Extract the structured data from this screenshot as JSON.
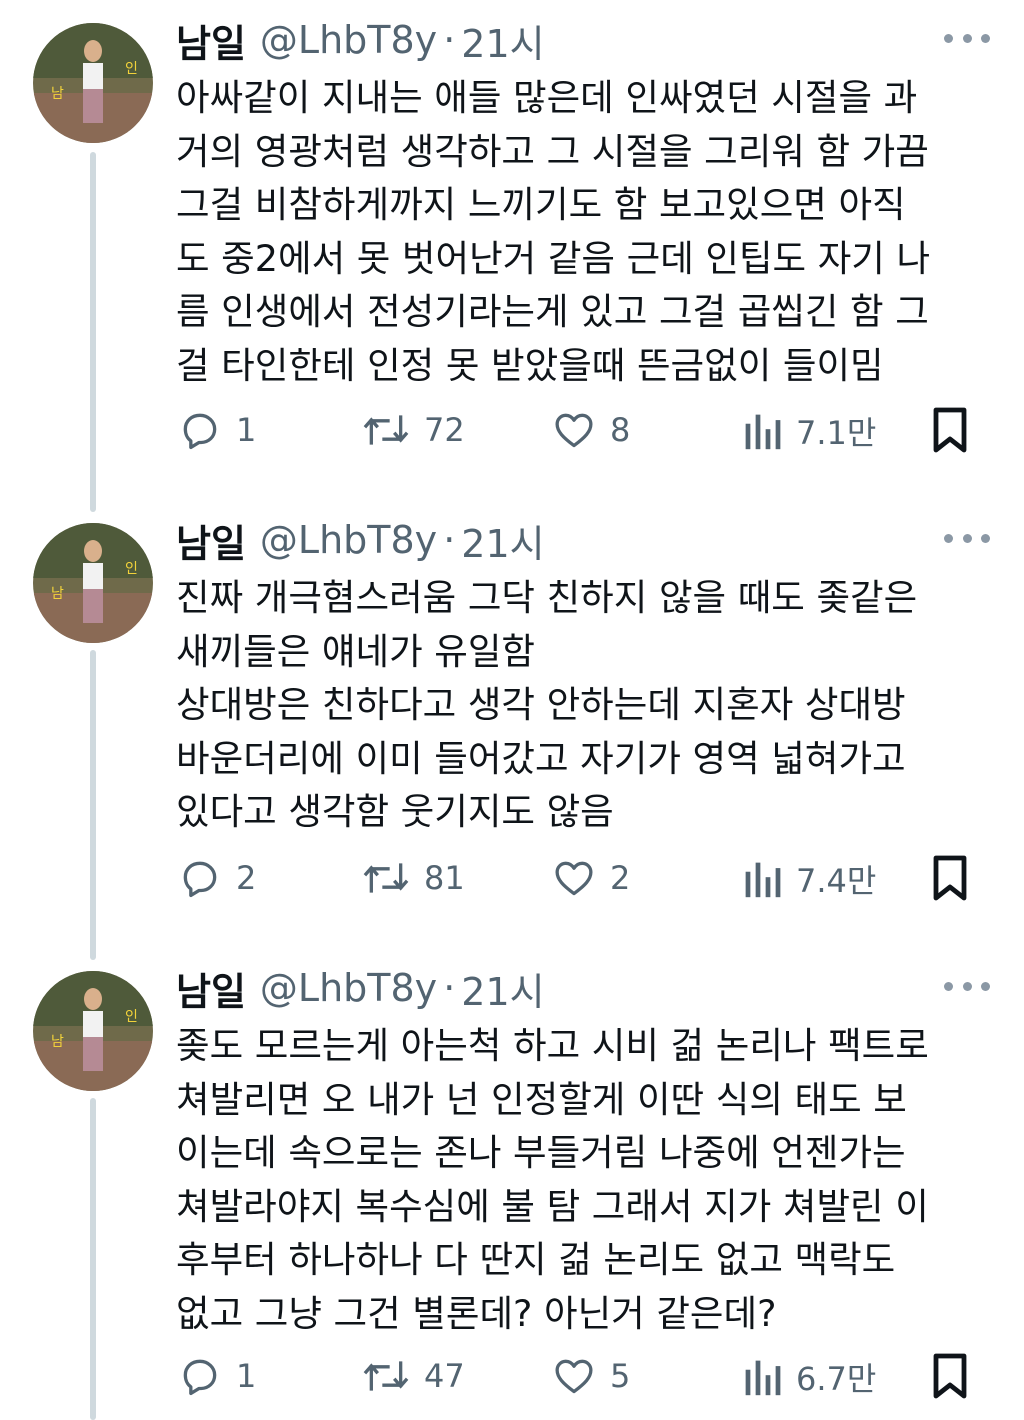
{
  "tweets": [
    {
      "name": "남일",
      "handle": "@LhbT8y",
      "dot": "·",
      "time": "21시",
      "lines": [
        "아싸같이 지내는 애들 많은데 인싸였던 시절을 과",
        "거의 영광처럼 생각하고 그 시절을 그리워 함 가끔",
        "그걸 비참하게까지 느끼기도 함 보고있으면 아직",
        "도 중2에서 못 벗어난거 같음 근데 인팁도 자기 나",
        "름 인생에서 전성기라는게 있고 그걸 곱씹긴 함 그",
        "걸 타인한테 인정 못 받았을때 뜬금없이 들이밈"
      ],
      "replies": "1",
      "retweets": "72",
      "likes": "8",
      "views": "7.1만"
    },
    {
      "name": "남일",
      "handle": "@LhbT8y",
      "dot": "·",
      "time": "21시",
      "lines": [
        "진짜 개극혐스러움 그닥 친하지 않을 때도 좆같은",
        "새끼들은 얘네가 유일함",
        "상대방은 친하다고 생각 안하는데 지혼자 상대방",
        "바운더리에 이미 들어갔고 자기가 영역 넓혀가고",
        "있다고 생각함 웃기지도 않음"
      ],
      "replies": "2",
      "retweets": "81",
      "likes": "2",
      "views": "7.4만"
    },
    {
      "name": "남일",
      "handle": "@LhbT8y",
      "dot": "·",
      "time": "21시",
      "lines": [
        "좆도 모르는게 아는척 하고 시비 걺 논리나 팩트로",
        "쳐발리면 오 내가 넌 인정할게 이딴 식의 태도 보",
        "이는데 속으로는 존나 부들거림 나중에 언젠가는",
        "쳐발라야지 복수심에 불 탐 그래서 지가 쳐발린 이",
        "후부터 하나하나 다 딴지 걺 논리도 없고 맥락도",
        "없고 그냥 그건 별론데? 아닌거 같은데?"
      ],
      "replies": "1",
      "retweets": "47",
      "likes": "5",
      "views": "6.7만"
    }
  ],
  "icons": {
    "reply": "reply-icon",
    "retweet": "retweet-icon",
    "like": "heart-icon",
    "views": "views-icon",
    "bookmark": "bookmark-icon",
    "more": "more-icon"
  },
  "colors": {
    "text": "#0f1419",
    "secondary": "#536471",
    "thread_line": "#cfd9de"
  }
}
